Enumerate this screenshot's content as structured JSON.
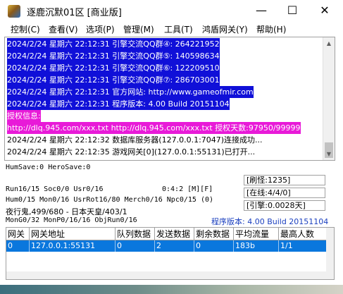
{
  "window": {
    "title": "逐鹿沉默01区 [商业版]"
  },
  "menu": [
    "控制(C)",
    "查看(V)",
    "选项(P)",
    "管理(M)",
    "工具(T)",
    "鸿盾网关(Y)",
    "帮助(H)"
  ],
  "log": [
    {
      "text": "2024/2/24 星期六 22:12:31 引擎交流QQ群④: 264221952",
      "fg": "#ffffff",
      "bg": "#1010d8"
    },
    {
      "text": "2024/2/24 星期六 22:12:31 引擎交流QQ群⑤: 140598634",
      "fg": "#ffffff",
      "bg": "#1010d8"
    },
    {
      "text": "2024/2/24 星期六 22:12:31 引擎交流QQ群⑥: 122209510",
      "fg": "#ffffff",
      "bg": "#1010d8"
    },
    {
      "text": "2024/2/24 星期六 22:12:31 引擎交流QQ群⑦: 286703001",
      "fg": "#ffffff",
      "bg": "#1010d8"
    },
    {
      "text": "2024/2/24 星期六 22:12:31 官方网站: http://www.gameofmir.com",
      "fg": "#ffffff",
      "bg": "#1010d8"
    },
    {
      "text": "2024/2/24 星期六 22:12:31 程序版本: 4.00 Build 20151104",
      "fg": "#ffffff",
      "bg": "#1010d8"
    },
    {
      "text": "授权信息:",
      "fg": "#ffffff",
      "bg": "#e81ad8"
    },
    {
      "text": "http://dlq.945.com/xxx.txt http://dlq.945.com/xxx.txt 授权天数:97950/99999",
      "fg": "#ffffff",
      "bg": "#e81ad8"
    },
    {
      "text": "2024/2/24 星期六 22:12:32 数据库服务器(127.0.0.1:7047)连接成功...",
      "fg": "#000000",
      "bg": ""
    },
    {
      "text": "2024/2/24 星期六 22:12:35 游戏网关[0](127.0.0.1:55131)已打开...",
      "fg": "#000000",
      "bg": ""
    }
  ],
  "status": {
    "save": "HumSave:0 HeroSave:0",
    "run": "Run16/15 Soc0/0 Usr0/16",
    "time": "0:4:2 [M][F]",
    "hum": "Hum0/15 Mon0/16 UsrRot16/80 Merch0/16 Npc0/15 (0)",
    "monster": "夜行鬼,499/680 - 日本天皇/403/1",
    "mongen": "MonG0/32 MonP0/16/16 ObjRun0/16",
    "refresh": "[刷怪:1235]",
    "online": "[在线:4/4/0]",
    "engine": "[引擎:0.0028天]",
    "version": "程序版本: 4.00 Build 20151104"
  },
  "gateway_table": {
    "headers": [
      "网关",
      "网关地址",
      "队列数据",
      "发送数据",
      "剩余数据",
      "平均流量",
      "最高人数"
    ],
    "rows": [
      [
        "0",
        "127.0.0.1:55131",
        "0",
        "2",
        "0",
        "183b",
        "1/1"
      ]
    ]
  },
  "colors": {
    "selection": "#0a77dd",
    "log_blue": "#1010d8",
    "log_magenta": "#e81ad8",
    "version": "#1a3fbf"
  }
}
